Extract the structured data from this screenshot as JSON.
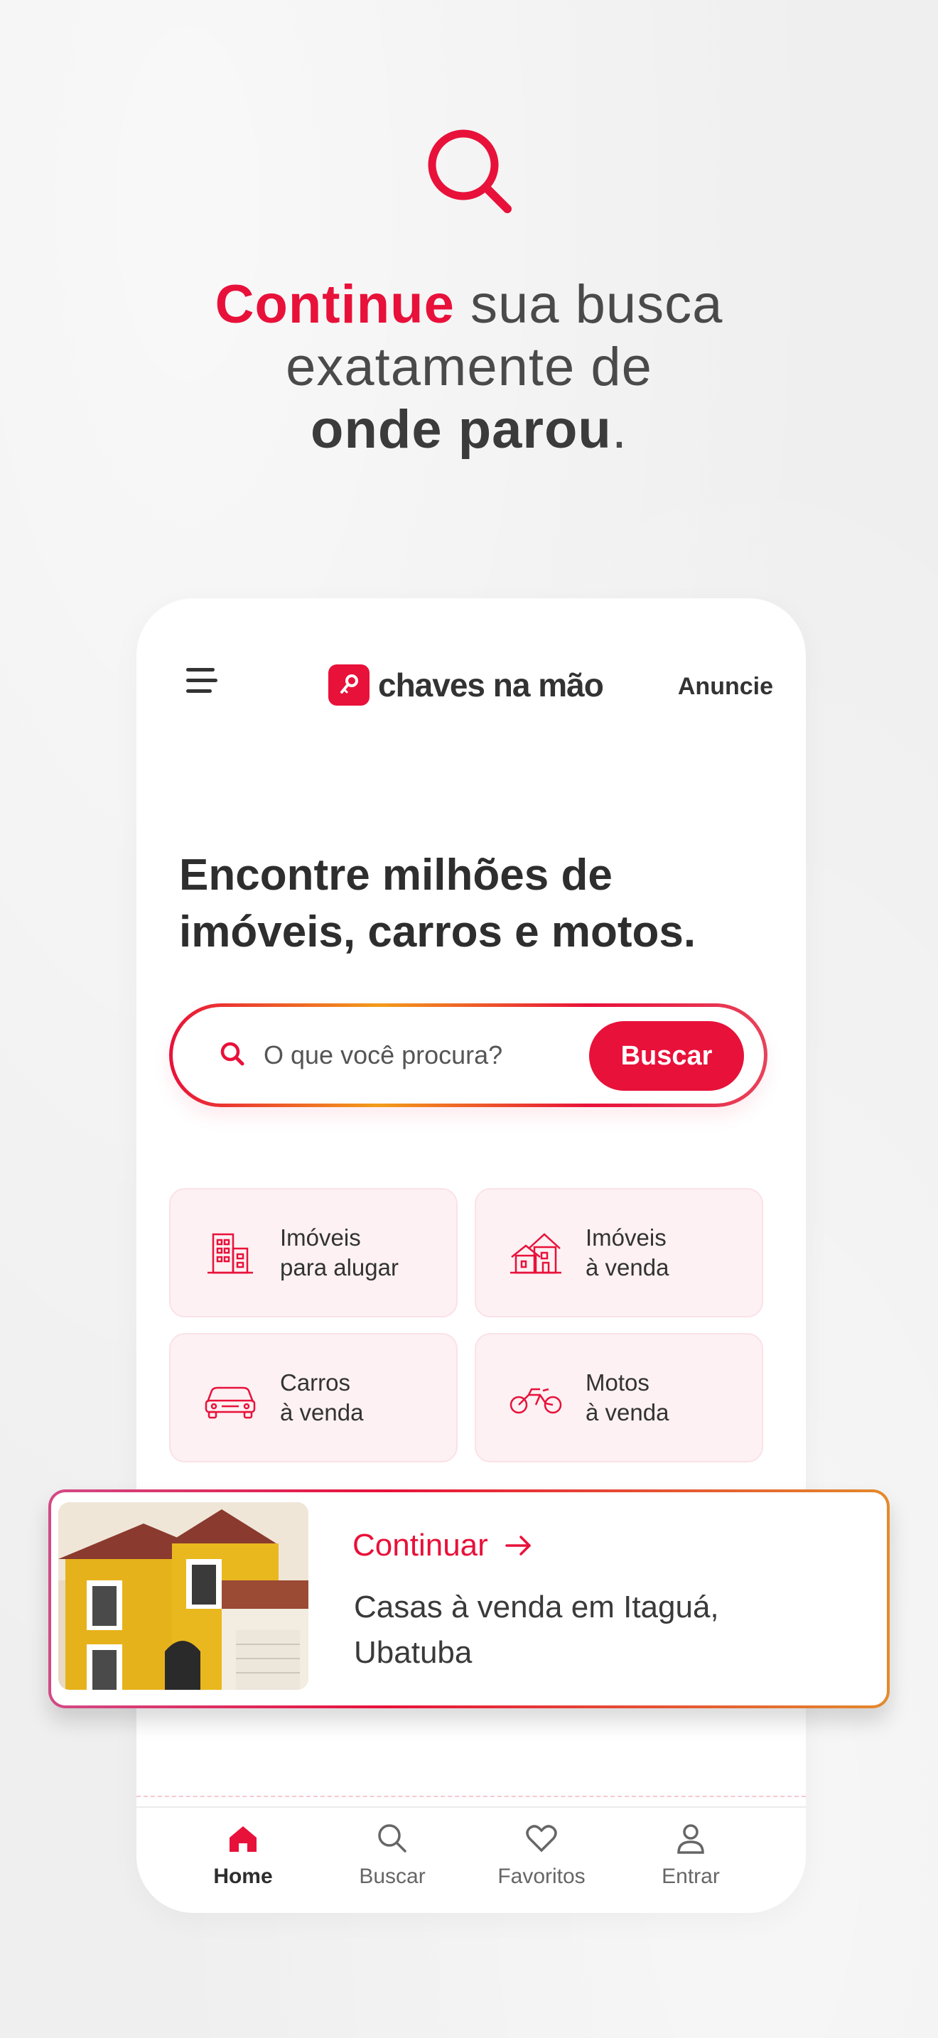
{
  "promo": {
    "accent": "Continue",
    "line1_rest": " sua busca",
    "line2": "exatamente de",
    "line3_strong": "onde parou",
    "line3_end": "."
  },
  "header": {
    "logo_text": "chaves na mão",
    "anuncie": "Anuncie"
  },
  "hero": {
    "headline": "Encontre milhões de imóveis, carros e motos."
  },
  "search": {
    "placeholder": "O que você procura?",
    "button": "Buscar"
  },
  "categories": [
    {
      "icon": "building-icon",
      "label": "Imóveis\npara alugar"
    },
    {
      "icon": "houses-icon",
      "label": "Imóveis\nà venda"
    },
    {
      "icon": "car-icon",
      "label": "Carros\nà venda"
    },
    {
      "icon": "motorcycle-icon",
      "label": "Motos\nà venda"
    }
  ],
  "continue_card": {
    "link": "Continuar",
    "description": "Casas à venda em Itaguá, Ubatuba"
  },
  "bottom_nav": [
    {
      "icon": "home-icon",
      "label": "Home",
      "active": true
    },
    {
      "icon": "search-icon",
      "label": "Buscar",
      "active": false
    },
    {
      "icon": "heart-icon",
      "label": "Favoritos",
      "active": false
    },
    {
      "icon": "user-icon",
      "label": "Entrar",
      "active": false
    }
  ],
  "colors": {
    "brand": "#e8113a",
    "text_dark": "#2e2e2e",
    "category_bg": "#fdf1f3"
  }
}
